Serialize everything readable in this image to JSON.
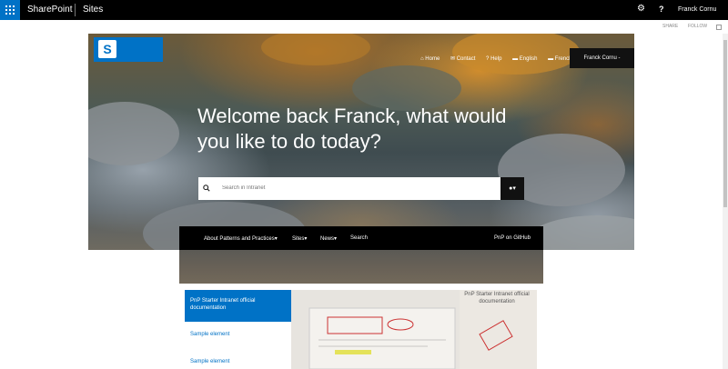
{
  "suite": {
    "brand": "SharePoint",
    "site": "Sites",
    "user": "Franck Cornu"
  },
  "actions": {
    "share": "SHARE",
    "follow": "FOLLOW"
  },
  "hero": {
    "title": "Welcome back Franck, what would you like to do today?"
  },
  "toplinks": {
    "home": "Home",
    "contact": "Contact",
    "help": "Help",
    "english": "English",
    "french": "French"
  },
  "usermenu": {
    "label": "Franck Cornu -"
  },
  "search": {
    "placeholder": "Search in Intranet"
  },
  "nav": [
    {
      "label": "About Patterns and Practices▾"
    },
    {
      "label": "Sites▾"
    },
    {
      "label": "News▾"
    },
    {
      "label": "Search"
    },
    {
      "label": "PnP on GitHub"
    }
  ],
  "tiles": {
    "active": "PnP Starter Intranet official documentation",
    "links": [
      "Sample element",
      "Sample element"
    ],
    "caption": "PnP Starter Intranet official documentation"
  },
  "colors": {
    "accent": "#0072c6",
    "suite": "#000000"
  }
}
